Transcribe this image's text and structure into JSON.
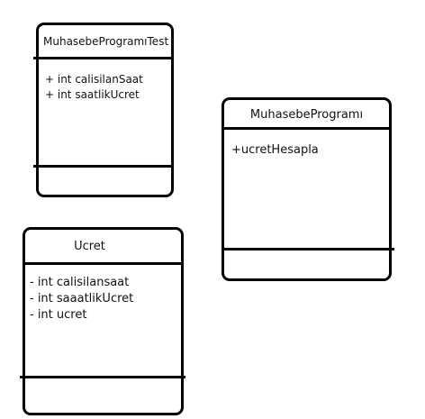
{
  "classes": [
    {
      "name": "MuhasebeProgramıTest",
      "members": [
        "+ int calisilanSaat",
        "+ int saatlikUcret"
      ]
    },
    {
      "name": "MuhasebeProgramı",
      "members": [
        "+ucretHesapla"
      ]
    },
    {
      "name": "Ucret",
      "members": [
        "- int calisilansaat",
        "- int saaatlikUcret",
        "- int ucret"
      ]
    }
  ]
}
